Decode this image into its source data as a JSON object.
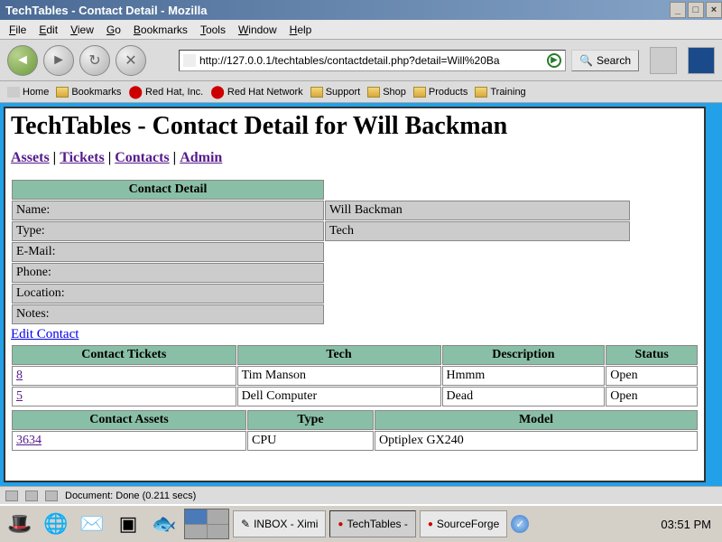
{
  "window": {
    "title": "TechTables - Contact Detail - Mozilla"
  },
  "menubar": [
    "File",
    "Edit",
    "View",
    "Go",
    "Bookmarks",
    "Tools",
    "Window",
    "Help"
  ],
  "url": "http://127.0.0.1/techtables/contactdetail.php?detail=Will%20Ba",
  "search_btn": "Search",
  "bookmarks": [
    "Home",
    "Bookmarks",
    "Red Hat, Inc.",
    "Red Hat Network",
    "Support",
    "Shop",
    "Products",
    "Training"
  ],
  "page": {
    "heading": "TechTables - Contact Detail for Will Backman",
    "nav": [
      "Assets",
      "Tickets",
      "Contacts",
      "Admin"
    ],
    "detail_header": "Contact Detail",
    "fields": [
      {
        "label": "Name:",
        "value": "Will Backman"
      },
      {
        "label": "Type:",
        "value": "Tech"
      },
      {
        "label": "E-Mail:",
        "value": ""
      },
      {
        "label": "Phone:",
        "value": ""
      },
      {
        "label": "Location:",
        "value": ""
      },
      {
        "label": "Notes:",
        "value": ""
      }
    ],
    "edit_link": "Edit Contact",
    "tickets_headers": [
      "Contact Tickets",
      "Tech",
      "Description",
      "Status"
    ],
    "tickets": [
      {
        "id": "8",
        "tech": "Tim Manson",
        "desc": "Hmmm",
        "status": "Open"
      },
      {
        "id": "5",
        "tech": "Dell Computer",
        "desc": "Dead",
        "status": "Open"
      }
    ],
    "assets_headers": [
      "Contact Assets",
      "Type",
      "Model"
    ],
    "assets": [
      {
        "id": "3634",
        "type": "CPU",
        "model": "Optiplex GX240"
      }
    ]
  },
  "status": "Document: Done (0.211 secs)",
  "taskbar": {
    "buttons": [
      "INBOX - Ximi",
      "TechTables -",
      "SourceForge"
    ],
    "clock": "03:51 PM"
  }
}
